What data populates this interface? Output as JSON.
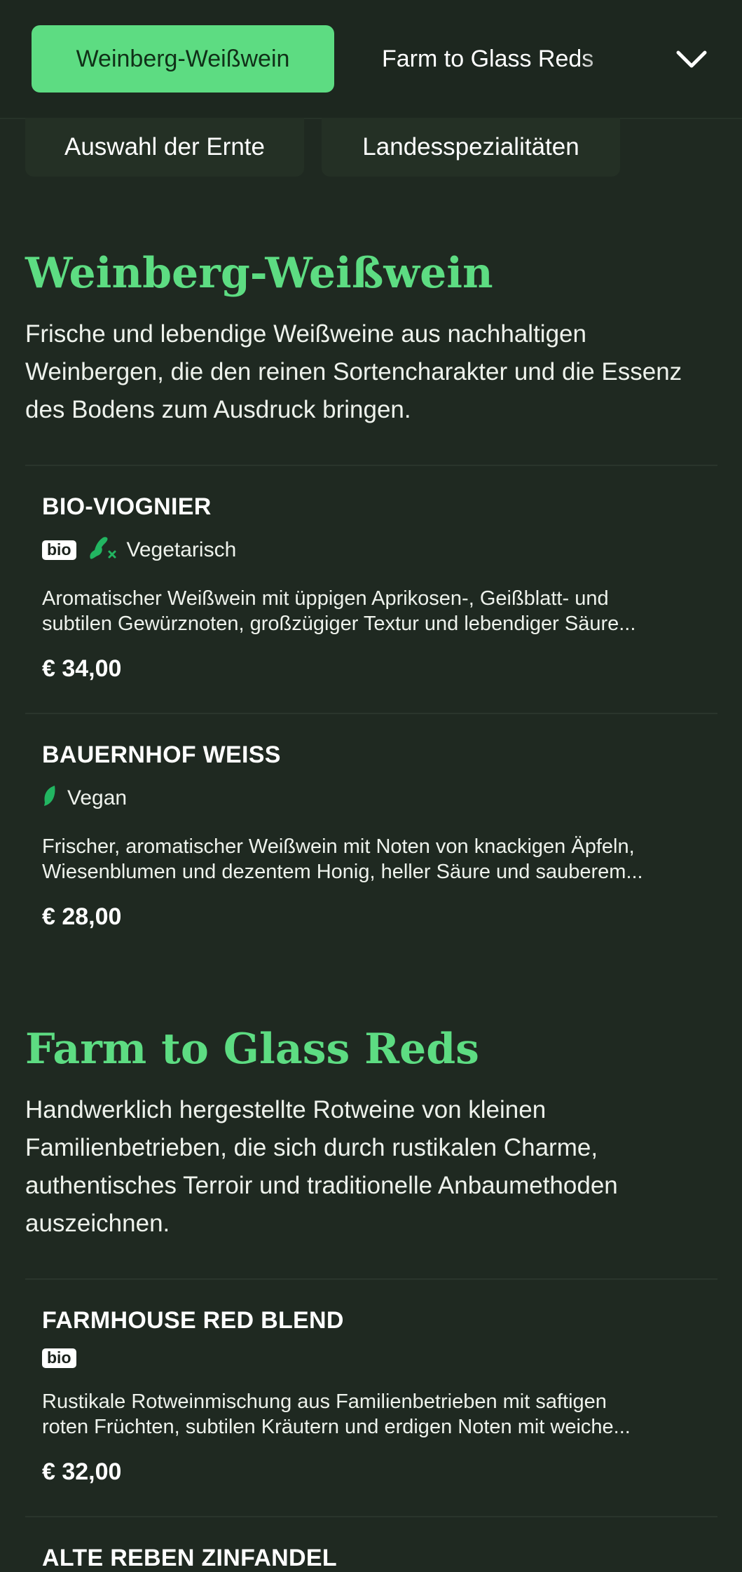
{
  "nav": {
    "active_tab": "Weinberg-Weißwein",
    "next_tab": "Farm to Glass Reds",
    "chips": [
      "Auswahl der Ernte",
      "Landesspezialitäten"
    ]
  },
  "sections": [
    {
      "title": "Weinberg-Weißwein",
      "description": "Frische und lebendige Weißweine aus nachhaltigen Weinbergen, die den reinen Sortencharakter und die Essenz des Bodens zum Ausdruck bringen.",
      "items": [
        {
          "name": "BIO-VIOGNIER",
          "badge": "bio",
          "diet": "Vegetarisch",
          "desc_line1": "Aromatischer Weißwein mit üppigen Aprikosen-, Geißblatt- und",
          "desc_line2": "subtilen Gewürznoten, großzügiger Textur und lebendiger Säure...",
          "price": "€ 34,00"
        },
        {
          "name": "BAUERNHOF WEISS",
          "diet": "Vegan",
          "desc_line1": "Frischer, aromatischer Weißwein mit Noten von knackigen Äpfeln,",
          "desc_line2": "Wiesenblumen und dezentem Honig, heller Säure und sauberem...",
          "price": "€ 28,00"
        }
      ]
    },
    {
      "title": "Farm to Glass Reds",
      "description": "Handwerklich hergestellte Rotweine von kleinen Familienbetrieben, die sich durch rustikalen Charme, authentisches Terroir und traditionelle Anbaumethoden auszeichnen.",
      "items": [
        {
          "name": "FARMHOUSE RED BLEND",
          "badge": "bio",
          "desc_line1": "Rustikale Rotweinmischung aus Familienbetrieben mit saftigen",
          "desc_line2": "roten Früchten, subtilen Kräutern und erdigen Noten mit weiche...",
          "price": "€ 32,00"
        },
        {
          "name": "ALTE REBEN ZINFANDEL"
        }
      ]
    }
  ],
  "colors": {
    "background": "#1f2921",
    "accent": "#5ddc82",
    "icon_green": "#22b561"
  },
  "icons": {
    "expand": "chevron-down-icon",
    "vegetarian": "vegetarian-icon",
    "vegan": "leaf-icon"
  }
}
